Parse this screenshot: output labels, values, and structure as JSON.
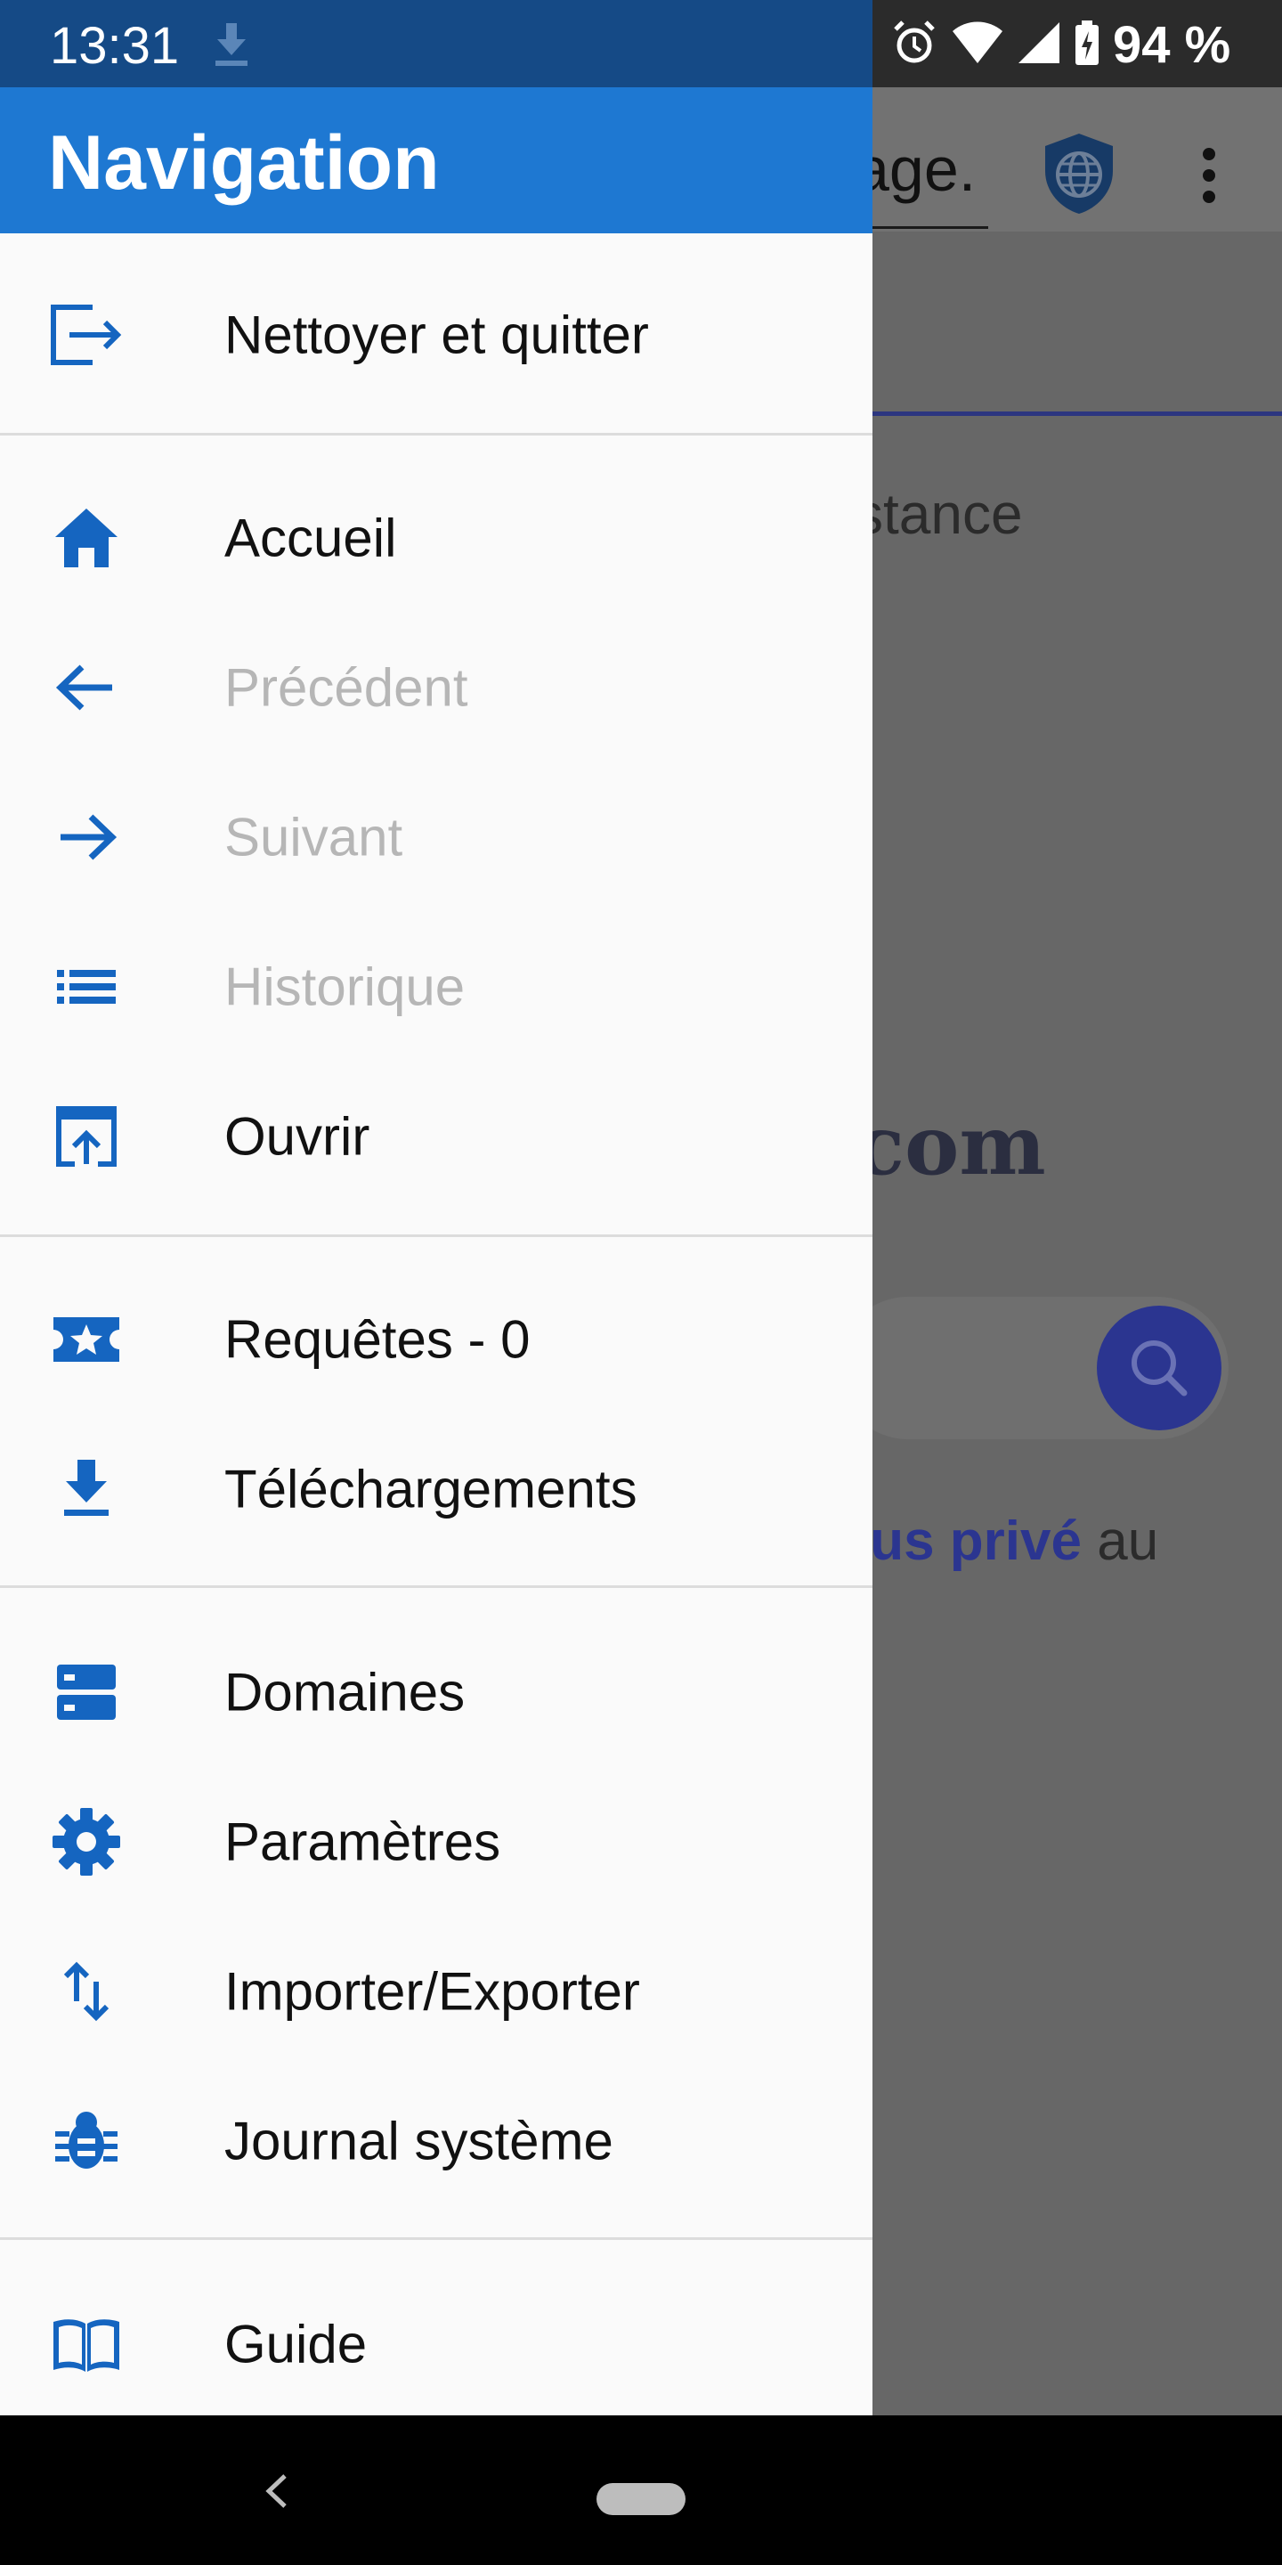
{
  "status_bar": {
    "time": "13:31",
    "battery": "94 %"
  },
  "drawer": {
    "title": "Navigation",
    "groups": [
      [
        {
          "label": "Nettoyer et quitter",
          "icon": "exit-icon",
          "enabled": true
        }
      ],
      [
        {
          "label": "Accueil",
          "icon": "home-icon",
          "enabled": true
        },
        {
          "label": "Précédent",
          "icon": "arrow-back-icon",
          "enabled": false
        },
        {
          "label": "Suivant",
          "icon": "arrow-forward-icon",
          "enabled": false
        },
        {
          "label": "Historique",
          "icon": "history-list-icon",
          "enabled": false
        },
        {
          "label": "Ouvrir",
          "icon": "open-in-browser-icon",
          "enabled": true
        }
      ],
      [
        {
          "label": "Requêtes - 0",
          "icon": "requests-star-icon",
          "enabled": true
        },
        {
          "label": "Téléchargements",
          "icon": "download-icon",
          "enabled": true
        }
      ],
      [
        {
          "label": "Domaines",
          "icon": "domains-icon",
          "enabled": true
        },
        {
          "label": "Paramètres",
          "icon": "settings-gear-icon",
          "enabled": true
        },
        {
          "label": "Importer/Exporter",
          "icon": "import-export-icon",
          "enabled": true
        },
        {
          "label": "Journal système",
          "icon": "bug-icon",
          "enabled": true
        }
      ],
      [
        {
          "label": "Guide",
          "icon": "book-icon",
          "enabled": true
        }
      ]
    ]
  },
  "background": {
    "url_fragment": "age.",
    "text_line1": "stance",
    "logo_fragment": "com",
    "text_line2_bold": "lus privé",
    "text_line2_rest": " au"
  },
  "colors": {
    "accent": "#1e78d2",
    "icon": "#1565c0",
    "disabled_text": "#b6b6b6"
  }
}
